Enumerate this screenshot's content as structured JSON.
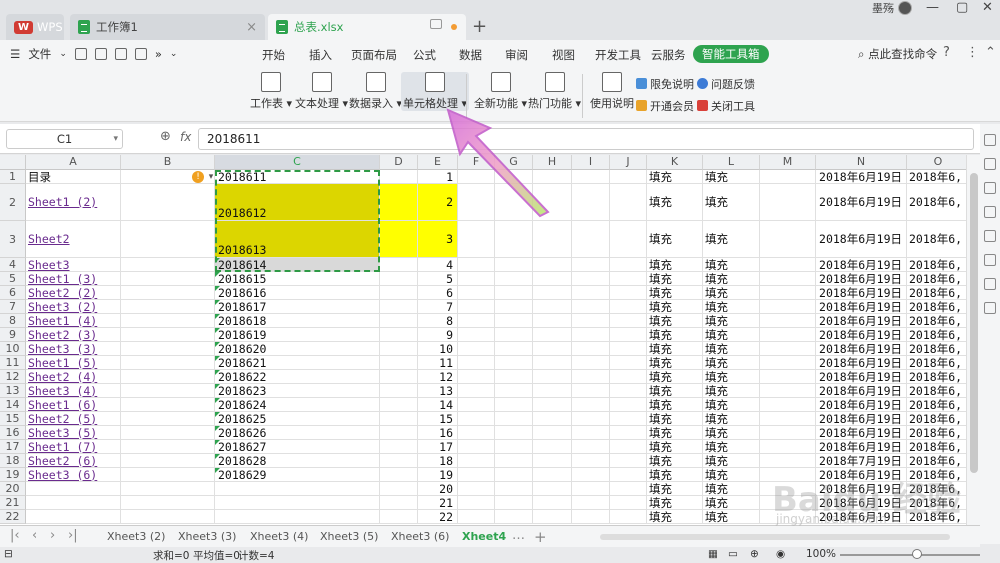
{
  "titlebar": {
    "tab_wps": "WPS",
    "tab_doc1": "工作簿1",
    "tab_doc2": "总表.xlsx",
    "user": "墨殇"
  },
  "menubar": {
    "file": "文件",
    "tabs": [
      "开始",
      "插入",
      "页面布局",
      "公式",
      "数据",
      "审阅",
      "视图",
      "开发工具",
      "云服务",
      "智能工具箱"
    ],
    "search": "点此查找命令"
  },
  "ribbon": {
    "buttons": [
      "工作表",
      "文本处理",
      "数据录入",
      "单元格处理",
      "全新功能",
      "热门功能",
      "使用说明"
    ],
    "small": [
      "限免说明",
      "问题反馈",
      "开通会员",
      "关闭工具"
    ]
  },
  "formula": {
    "namebox": "C1",
    "fx": "fx",
    "value": "2018611"
  },
  "grid": {
    "columns": [
      "A",
      "B",
      "C",
      "D",
      "E",
      "F",
      "G",
      "H",
      "I",
      "J",
      "K",
      "L",
      "M",
      "N",
      "O"
    ],
    "rows": [
      {
        "n": "1",
        "a": "目录",
        "c": "2018611",
        "e": "1",
        "k": "填充",
        "l": "填充",
        "n2": "2018年6月19日",
        "o": "2018年6,"
      },
      {
        "n": "2",
        "a": "Sheet1 (2)",
        "c": "2018612",
        "e": "2",
        "k": "填充",
        "l": "填充",
        "n2": "2018年6月19日",
        "o": "2018年6,"
      },
      {
        "n": "3",
        "a": "Sheet2",
        "c": "2018613",
        "e": "3",
        "k": "填充",
        "l": "填充",
        "n2": "2018年6月19日",
        "o": "2018年6,"
      },
      {
        "n": "4",
        "a": "Sheet3",
        "c": "2018614",
        "e": "4",
        "k": "填充",
        "l": "填充",
        "n2": "2018年6月19日",
        "o": "2018年6,"
      },
      {
        "n": "5",
        "a": "Sheet1 (3)",
        "c": "2018615",
        "e": "5",
        "k": "填充",
        "l": "填充",
        "n2": "2018年6月19日",
        "o": "2018年6,"
      },
      {
        "n": "6",
        "a": "Sheet2 (2)",
        "c": "2018616",
        "e": "6",
        "k": "填充",
        "l": "填充",
        "n2": "2018年6月19日",
        "o": "2018年6,"
      },
      {
        "n": "7",
        "a": "Sheet3 (2)",
        "c": "2018617",
        "e": "7",
        "k": "填充",
        "l": "填充",
        "n2": "2018年6月19日",
        "o": "2018年6,"
      },
      {
        "n": "8",
        "a": "Sheet1 (4)",
        "c": "2018618",
        "e": "8",
        "k": "填充",
        "l": "填充",
        "n2": "2018年6月19日",
        "o": "2018年6,"
      },
      {
        "n": "9",
        "a": "Sheet2 (3)",
        "c": "2018619",
        "e": "9",
        "k": "填充",
        "l": "填充",
        "n2": "2018年6月19日",
        "o": "2018年6,"
      },
      {
        "n": "10",
        "a": "Sheet3 (3)",
        "c": "2018620",
        "e": "10",
        "k": "填充",
        "l": "填充",
        "n2": "2018年6月19日",
        "o": "2018年6,"
      },
      {
        "n": "11",
        "a": "Sheet1 (5)",
        "c": "2018621",
        "e": "11",
        "k": "填充",
        "l": "填充",
        "n2": "2018年6月19日",
        "o": "2018年6,"
      },
      {
        "n": "12",
        "a": "Sheet2 (4)",
        "c": "2018622",
        "e": "12",
        "k": "填充",
        "l": "填充",
        "n2": "2018年6月19日",
        "o": "2018年6,"
      },
      {
        "n": "13",
        "a": "Sheet3 (4)",
        "c": "2018623",
        "e": "13",
        "k": "填充",
        "l": "填充",
        "n2": "2018年6月19日",
        "o": "2018年6,"
      },
      {
        "n": "14",
        "a": "Sheet1 (6)",
        "c": "2018624",
        "e": "14",
        "k": "填充",
        "l": "填充",
        "n2": "2018年6月19日",
        "o": "2018年6,"
      },
      {
        "n": "15",
        "a": "Sheet2 (5)",
        "c": "2018625",
        "e": "15",
        "k": "填充",
        "l": "填充",
        "n2": "2018年6月19日",
        "o": "2018年6,"
      },
      {
        "n": "16",
        "a": "Sheet3 (5)",
        "c": "2018626",
        "e": "16",
        "k": "填充",
        "l": "填充",
        "n2": "2018年6月19日",
        "o": "2018年6,"
      },
      {
        "n": "17",
        "a": "Sheet1 (7)",
        "c": "2018627",
        "e": "17",
        "k": "填充",
        "l": "填充",
        "n2": "2018年6月19日",
        "o": "2018年6,"
      },
      {
        "n": "18",
        "a": "Sheet2 (6)",
        "c": "2018628",
        "e": "18",
        "k": "填充",
        "l": "填充",
        "n2": "2018年7月19日",
        "o": "2018年6,"
      },
      {
        "n": "19",
        "a": "Sheet3 (6)",
        "c": "2018629",
        "e": "19",
        "k": "填充",
        "l": "填充",
        "n2": "2018年6月19日",
        "o": "2018年6,"
      },
      {
        "n": "20",
        "a": "",
        "c": "",
        "e": "20",
        "k": "填充",
        "l": "填充",
        "n2": "2018年6月19日",
        "o": "2018年6,"
      },
      {
        "n": "21",
        "a": "",
        "c": "",
        "e": "21",
        "k": "填充",
        "l": "填充",
        "n2": "2018年6月19日",
        "o": "2018年6,"
      },
      {
        "n": "22",
        "a": "",
        "c": "",
        "e": "22",
        "k": "填充",
        "l": "填充",
        "n2": "2018年6月19日",
        "o": "2018年6,"
      }
    ]
  },
  "sheet_tabs": [
    "Xheet3 (2)",
    "Xheet3 (3)",
    "Xheet3 (4)",
    "Xheet3 (5)",
    "Xheet3 (6)",
    "Xheet4"
  ],
  "status": {
    "sum": "求和=0",
    "avg": "平均值=0",
    "count": "计数=4",
    "zoom": "100%"
  },
  "watermark": {
    "main": "Baidu 经验",
    "sub": "jingyan.baidu.com"
  },
  "colors": {
    "accent": "#2ea34f",
    "fill_olive": "#dcd600",
    "fill_yellow": "#ffff00"
  }
}
